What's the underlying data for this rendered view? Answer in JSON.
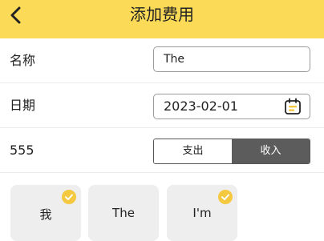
{
  "header": {
    "title": "添加费用",
    "back_icon": "chevron-left-icon",
    "background_color": "#fada57"
  },
  "form": {
    "name": {
      "label": "名称",
      "value": "The"
    },
    "date": {
      "label": "日期",
      "value": "2023-02-01",
      "icon": "calendar-icon"
    },
    "type": {
      "label": "555",
      "options": [
        "支出",
        "收入"
      ],
      "selected": "收入"
    }
  },
  "cards": [
    {
      "label": "我",
      "checked": true
    },
    {
      "label": "The",
      "checked": false
    },
    {
      "label": "I'm",
      "checked": true
    }
  ],
  "colors": {
    "accent": "#fada57",
    "check_badge": "#f4c83f",
    "selected_segment": "#5c5c5c",
    "card_bg": "#eeeeee"
  }
}
